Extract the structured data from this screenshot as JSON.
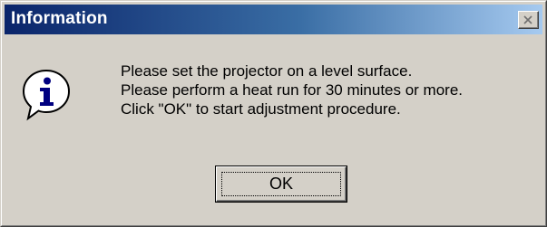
{
  "window": {
    "title": "Information"
  },
  "message": {
    "lines": [
      "Please set the projector on a level surface.",
      "Please perform a heat run for 30 minutes or more.",
      "Click \"OK\" to start adjustment procedure."
    ]
  },
  "buttons": {
    "ok_label": "OK"
  },
  "icons": {
    "dialog_icon": "information-icon",
    "close": "close-icon"
  },
  "colors": {
    "title_gradient_start": "#0a246a",
    "title_gradient_end": "#a6caf0",
    "dialog_face": "#d4d0c8"
  }
}
